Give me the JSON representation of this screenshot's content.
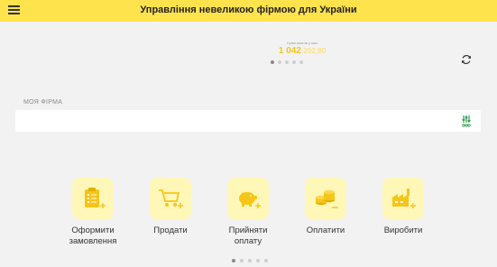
{
  "header": {
    "title": "Управління невеликою фірмою для України"
  },
  "balance": {
    "caption": "Сума коштів у касі",
    "amount": "1 042",
    "cents": "202,80"
  },
  "carousel_top": {
    "count": 5,
    "active": 0
  },
  "firm_section": {
    "label": "МОЯ ФІРМА"
  },
  "actions": [
    {
      "label": "Оформити замовлення",
      "icon": "order-form-icon"
    },
    {
      "label": "Продати",
      "icon": "cart-plus-icon"
    },
    {
      "label": "Прийняти оплату",
      "icon": "piggy-bank-icon"
    },
    {
      "label": "Оплатити",
      "icon": "coins-minus-icon"
    },
    {
      "label": "Виробити",
      "icon": "factory-plus-icon"
    }
  ],
  "carousel_bottom": {
    "count": 5,
    "active": 0
  },
  "colors": {
    "accent": "#ffe34d",
    "icon_tile": "#fff7b8",
    "icon_fg": "#f5c518",
    "settings_icon": "#2e9b4f"
  }
}
